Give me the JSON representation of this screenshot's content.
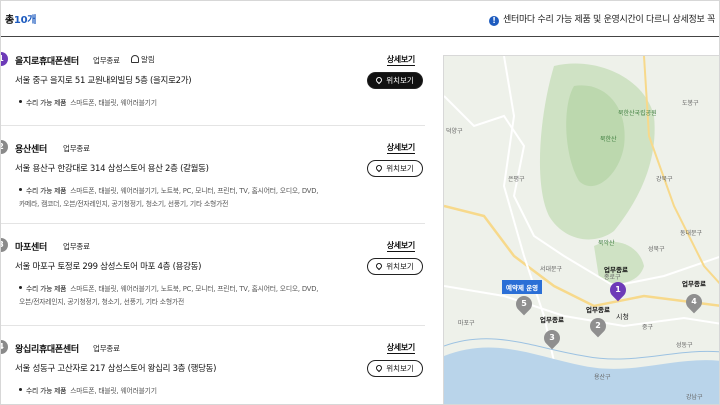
{
  "header": {
    "count_prefix": "총",
    "count_value": "10개",
    "notice": "센터마다 수리 가능 제품 및 운영시간이 다르니 상세정보 꼭"
  },
  "labels": {
    "closed": "업무종료",
    "alarm": "알림",
    "detail": "상세보기",
    "locate": "위치보기",
    "repair_label": "수리 가능 제품"
  },
  "centers": [
    {
      "pin": "1",
      "name": "을지로휴대폰센터",
      "status": "업무종료",
      "address": "서울 중구 을지로 51 교원내외빌딩 5층 (을지로2가)",
      "repair_line1": "스마트폰, 태블릿, 웨어러블기기",
      "repair_line2": ""
    },
    {
      "pin": "2",
      "name": "용산센터",
      "status": "업무종료",
      "address": "서울 용산구 한강대로 314 삼성스토어 용산 2층 (갈월동)",
      "repair_line1": "스마트폰, 태블릿, 웨어러블기기, 노트북, PC, 모니터, 프린터, TV, 홈시어터, 오디오, DVD,",
      "repair_line2": "카메라, 캠코더, 오븐/전자레인지, 공기청정기, 청소기, 선풍기, 기타 소형가전"
    },
    {
      "pin": "3",
      "name": "마포센터",
      "status": "업무종료",
      "address": "서울 마포구 토정로 299 삼성스토어 마포 4층 (용강동)",
      "repair_line1": "스마트폰, 태블릿, 웨어러블기기, 노트북, PC, 모니터, 프린터, TV, 홈시어터, 오디오, DVD,",
      "repair_line2": "오븐/전자레인지, 공기청정기, 청소기, 선풍기, 기타 소형가전"
    },
    {
      "pin": "4",
      "name": "왕십리휴대폰센터",
      "status": "업무종료",
      "address": "서울 성동구 고산자로 217 삼성스토어 왕십리 3층 (행당동)",
      "repair_line1": "스마트폰, 태블릿, 웨어러블기기",
      "repair_line2": ""
    }
  ],
  "map": {
    "labels": [
      "도봉구",
      "북한산국립공원",
      "북한산",
      "강북구",
      "덕양구",
      "은평구",
      "성북구",
      "북악산",
      "종로구",
      "서대문구",
      "시청",
      "중구",
      "마포구",
      "용산구",
      "강남구",
      "성동구",
      "동대문구"
    ],
    "status_labels": [
      "업무종료",
      "업무종료",
      "업무종료",
      "업무종료"
    ],
    "badge": "예약제 운영",
    "pins": [
      "1",
      "2",
      "3",
      "4",
      "5"
    ]
  },
  "colors": {
    "accent": "#1d5bbf",
    "pin_primary": "#6d3bb8",
    "pin_secondary": "#8f8f8f"
  }
}
